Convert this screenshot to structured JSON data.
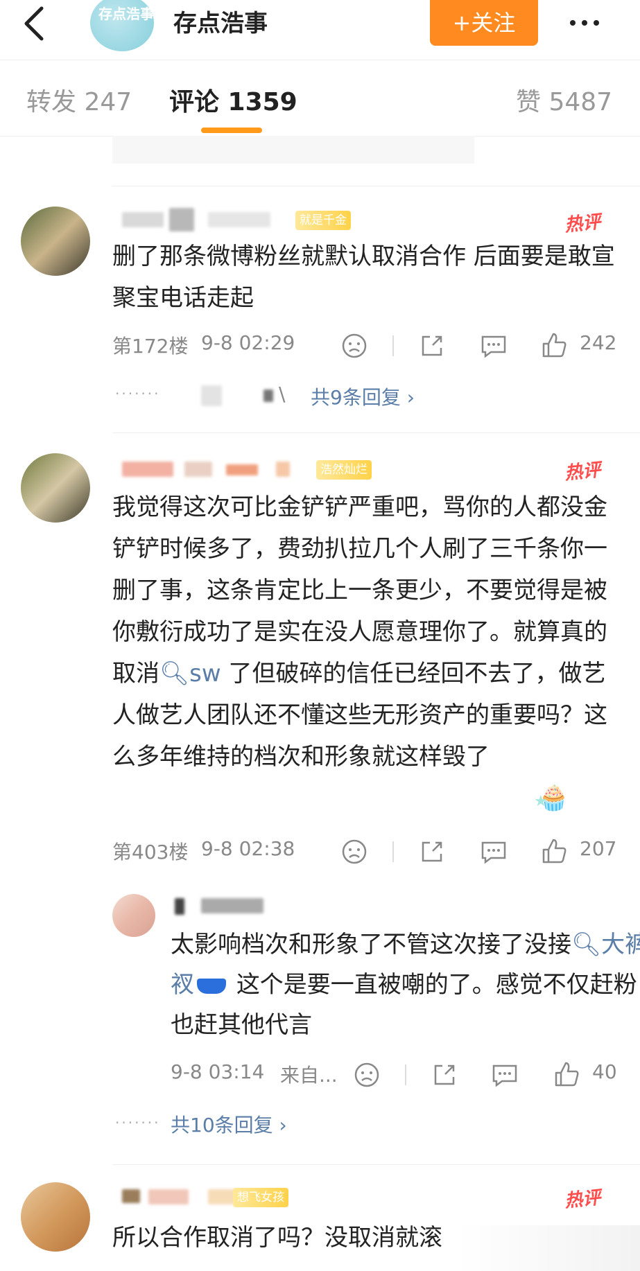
{
  "header": {
    "account_name": "存点浩事",
    "logo_text": "存点浩事",
    "follow_label": "+关注"
  },
  "tabs": [
    {
      "label": "转发 247"
    },
    {
      "label": "评论 1359"
    },
    {
      "label": "赞 5487"
    }
  ],
  "comments": [
    {
      "badge": "就是千金",
      "hot": "热评",
      "text": "删了那条微博粉丝就默认取消合作 后面要是敢宣聚宝电话走起",
      "floor": "第172楼",
      "time": "9-8 02:29",
      "likes": "242",
      "replies_label": "共9条回复",
      "replies_prefix": "\\"
    },
    {
      "badge": "浩然灿烂",
      "hot": "热评",
      "text_before_link": "我觉得这次可比金铲铲严重吧，骂你的人都没金铲铲时候多了，费劲扒拉几个人刷了三千条你一删了事，这条肯定比上一条更少，不要觉得是被你敷衍成功了是实在没人愿意理你了。就算真的取消",
      "link": "sw",
      "text_after_link": "了但破碎的信任已经回不去了，做艺人做艺人团队还不懂这些无形资产的重要吗？这么多年维持的档次和形象就这样毁了",
      "floor": "第403楼",
      "time": "9-8 02:38",
      "likes": "207",
      "reply": {
        "text_before_link": "太影响档次和形象了不管这次接了没接",
        "link": "大裤衩",
        "text_after_link": "这个是要一直被嘲的了。感觉不仅赶粉也赶其他代言",
        "time": "9-8 03:14",
        "source": "来自...",
        "likes": "40"
      },
      "replies_label": "共10条回复"
    },
    {
      "badge": "想飞女孩",
      "hot": "热评",
      "text": "所以合作取消了吗？没取消就滚"
    }
  ],
  "colors": {
    "accent": "#ff8a1f",
    "link": "#5a7ea8",
    "hot": "#ff4d4d",
    "tab_underline": "#ff9a1a"
  }
}
